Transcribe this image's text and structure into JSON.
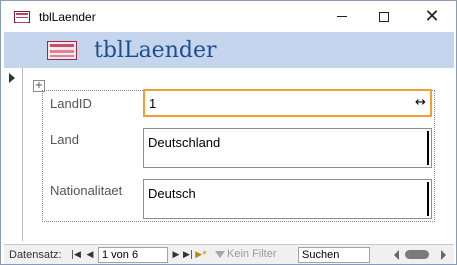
{
  "window": {
    "title": "tblLaender",
    "controls": [
      "minimize",
      "maximize",
      "close"
    ]
  },
  "form": {
    "title": "tblLaender",
    "fields": [
      {
        "label": "LandID",
        "value": "1"
      },
      {
        "label": "Land",
        "value": "Deutschland"
      },
      {
        "label": "Nationalitaet",
        "value": "Deutsch"
      }
    ]
  },
  "navigation": {
    "label": "Datensatz:",
    "record_position": "1 von 6",
    "filter_label": "Kein Filter",
    "search_placeholder": "Suchen"
  },
  "icons": {
    "app": "form-icon",
    "cursor": "horizontal-resize-icon"
  },
  "colors": {
    "header_band": "#c5d5ee",
    "title_text": "#1f4e8f",
    "focus_border": "#f0a030"
  }
}
